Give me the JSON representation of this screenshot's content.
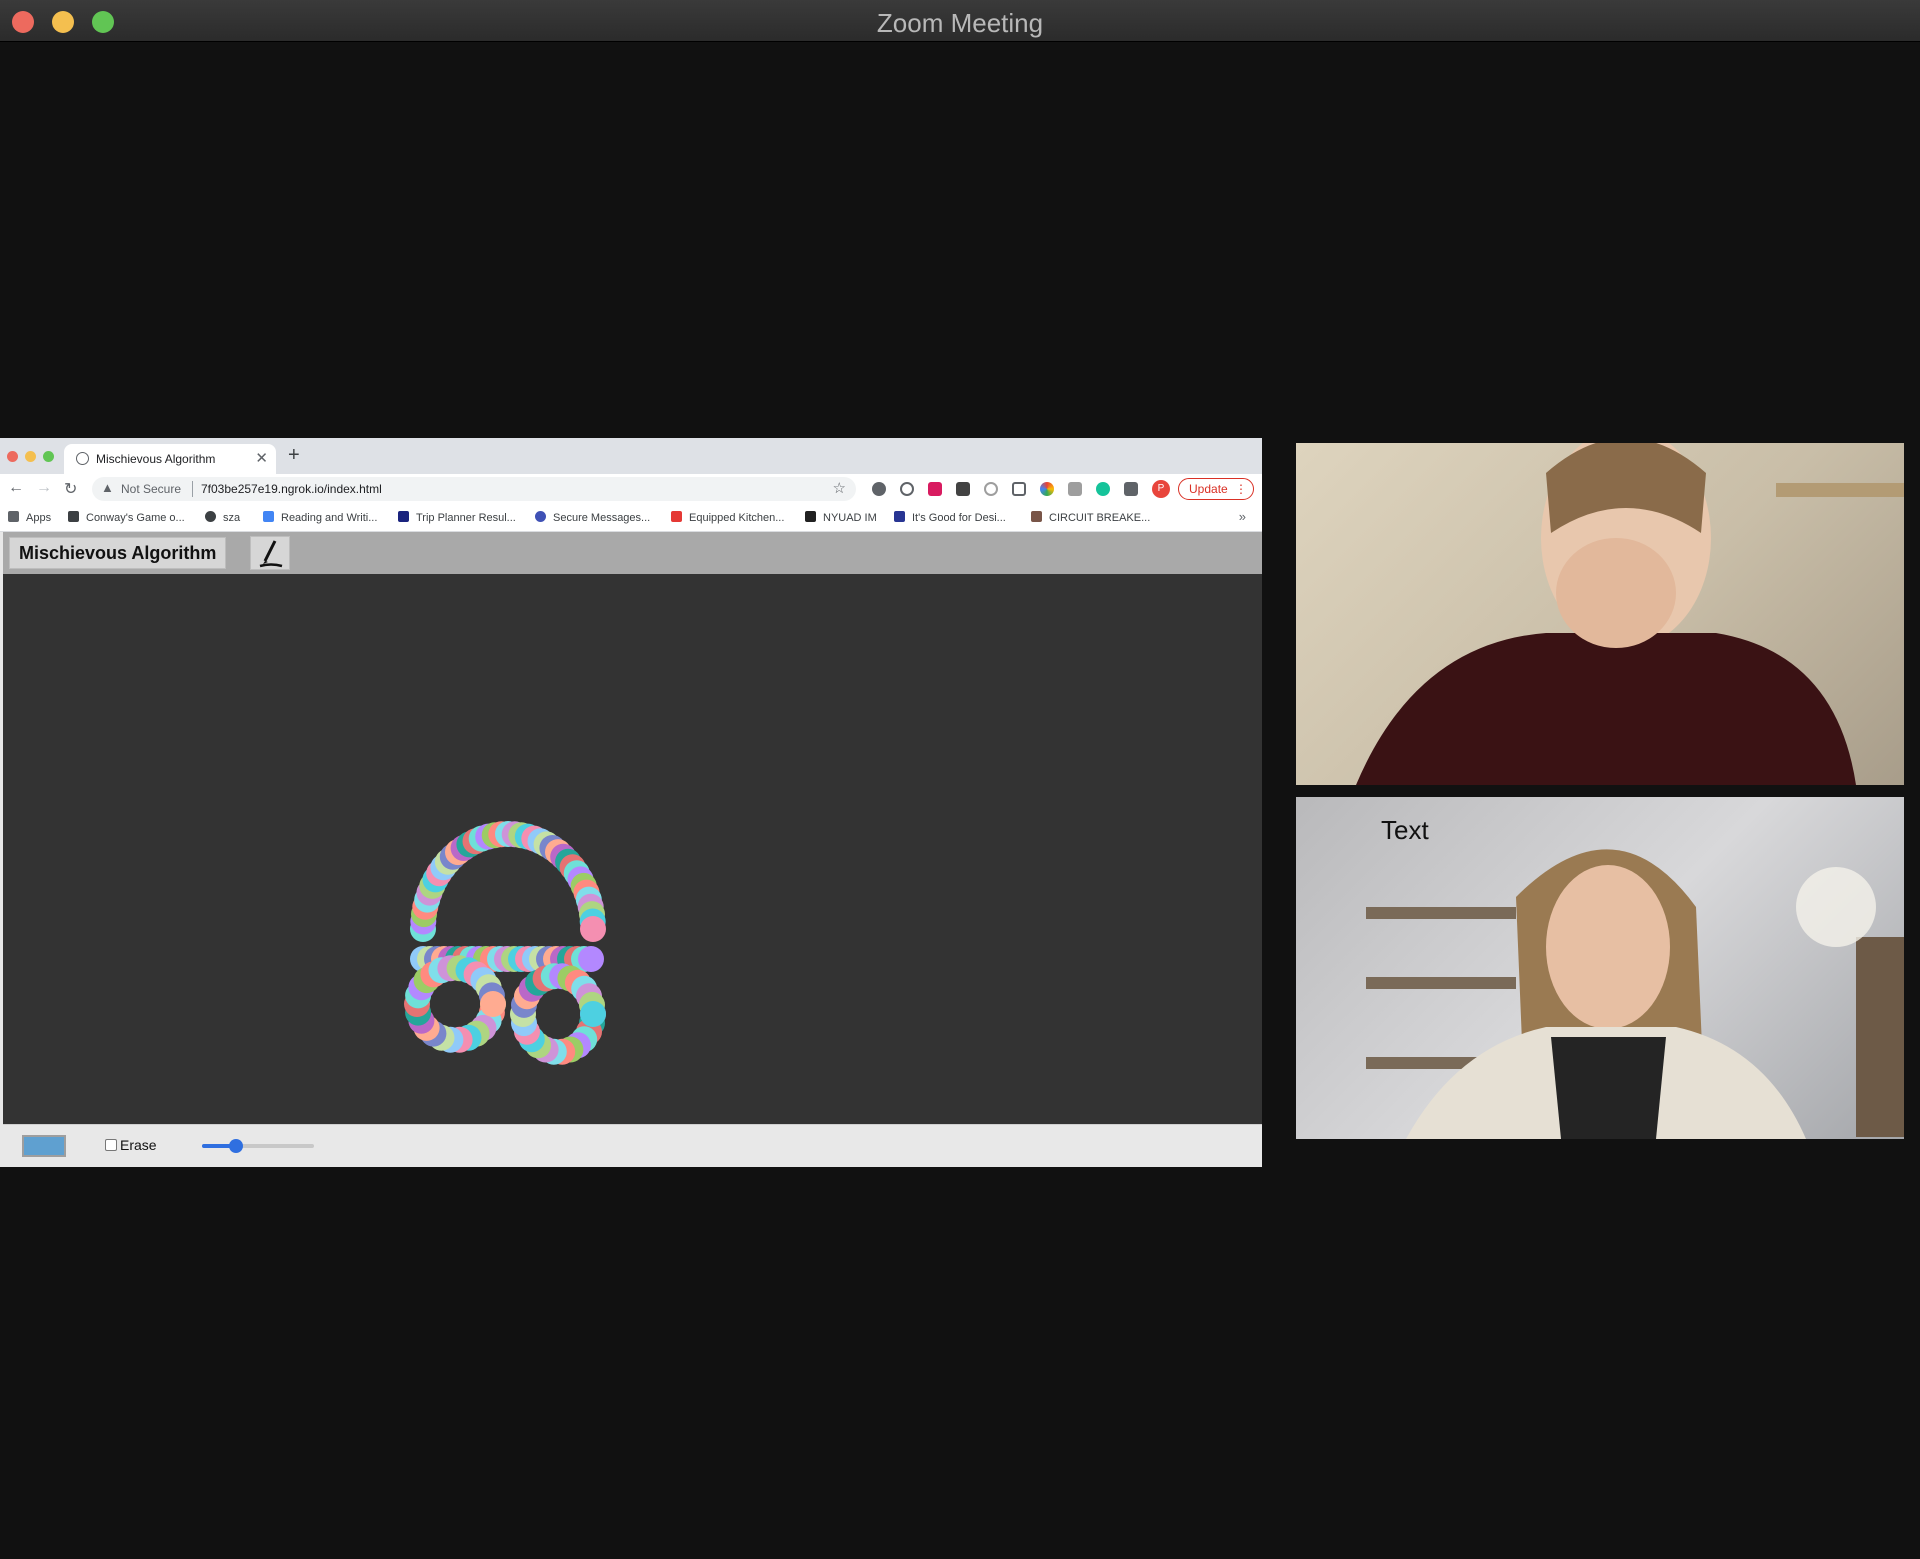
{
  "window": {
    "title": "Zoom Meeting"
  },
  "browser": {
    "tab_title": "Mischievous Algorithm",
    "security_label": "Not Secure",
    "url": "7f03be257e19.ngrok.io/index.html",
    "profile_initial": "P",
    "update_label": "Update",
    "bookmarks": [
      {
        "label": "Apps",
        "icon_color": "#5f6368"
      },
      {
        "label": "Conway's Game o...",
        "icon_color": "#3c4043"
      },
      {
        "label": "sza",
        "icon_color": "#3c4043"
      },
      {
        "label": "Reading and Writi...",
        "icon_color": "#4285f4"
      },
      {
        "label": "Trip Planner Resul...",
        "icon_color": "#1a237e"
      },
      {
        "label": "Secure Messages...",
        "icon_color": "#3f51b5"
      },
      {
        "label": "Equipped Kitchen...",
        "icon_color": "#e53935"
      },
      {
        "label": "NYUAD IM",
        "icon_color": "#212121"
      },
      {
        "label": "It's Good for Desi...",
        "icon_color": "#283593"
      },
      {
        "label": "CIRCUIT BREAKE...",
        "icon_color": "#795548"
      }
    ]
  },
  "app": {
    "title": "Mischievous Algorithm",
    "erase_label": "Erase",
    "swatch_color": "#5fa0d0",
    "brush_size": 0.3
  },
  "participants": [
    {
      "label": ""
    },
    {
      "label": "Text"
    }
  ]
}
